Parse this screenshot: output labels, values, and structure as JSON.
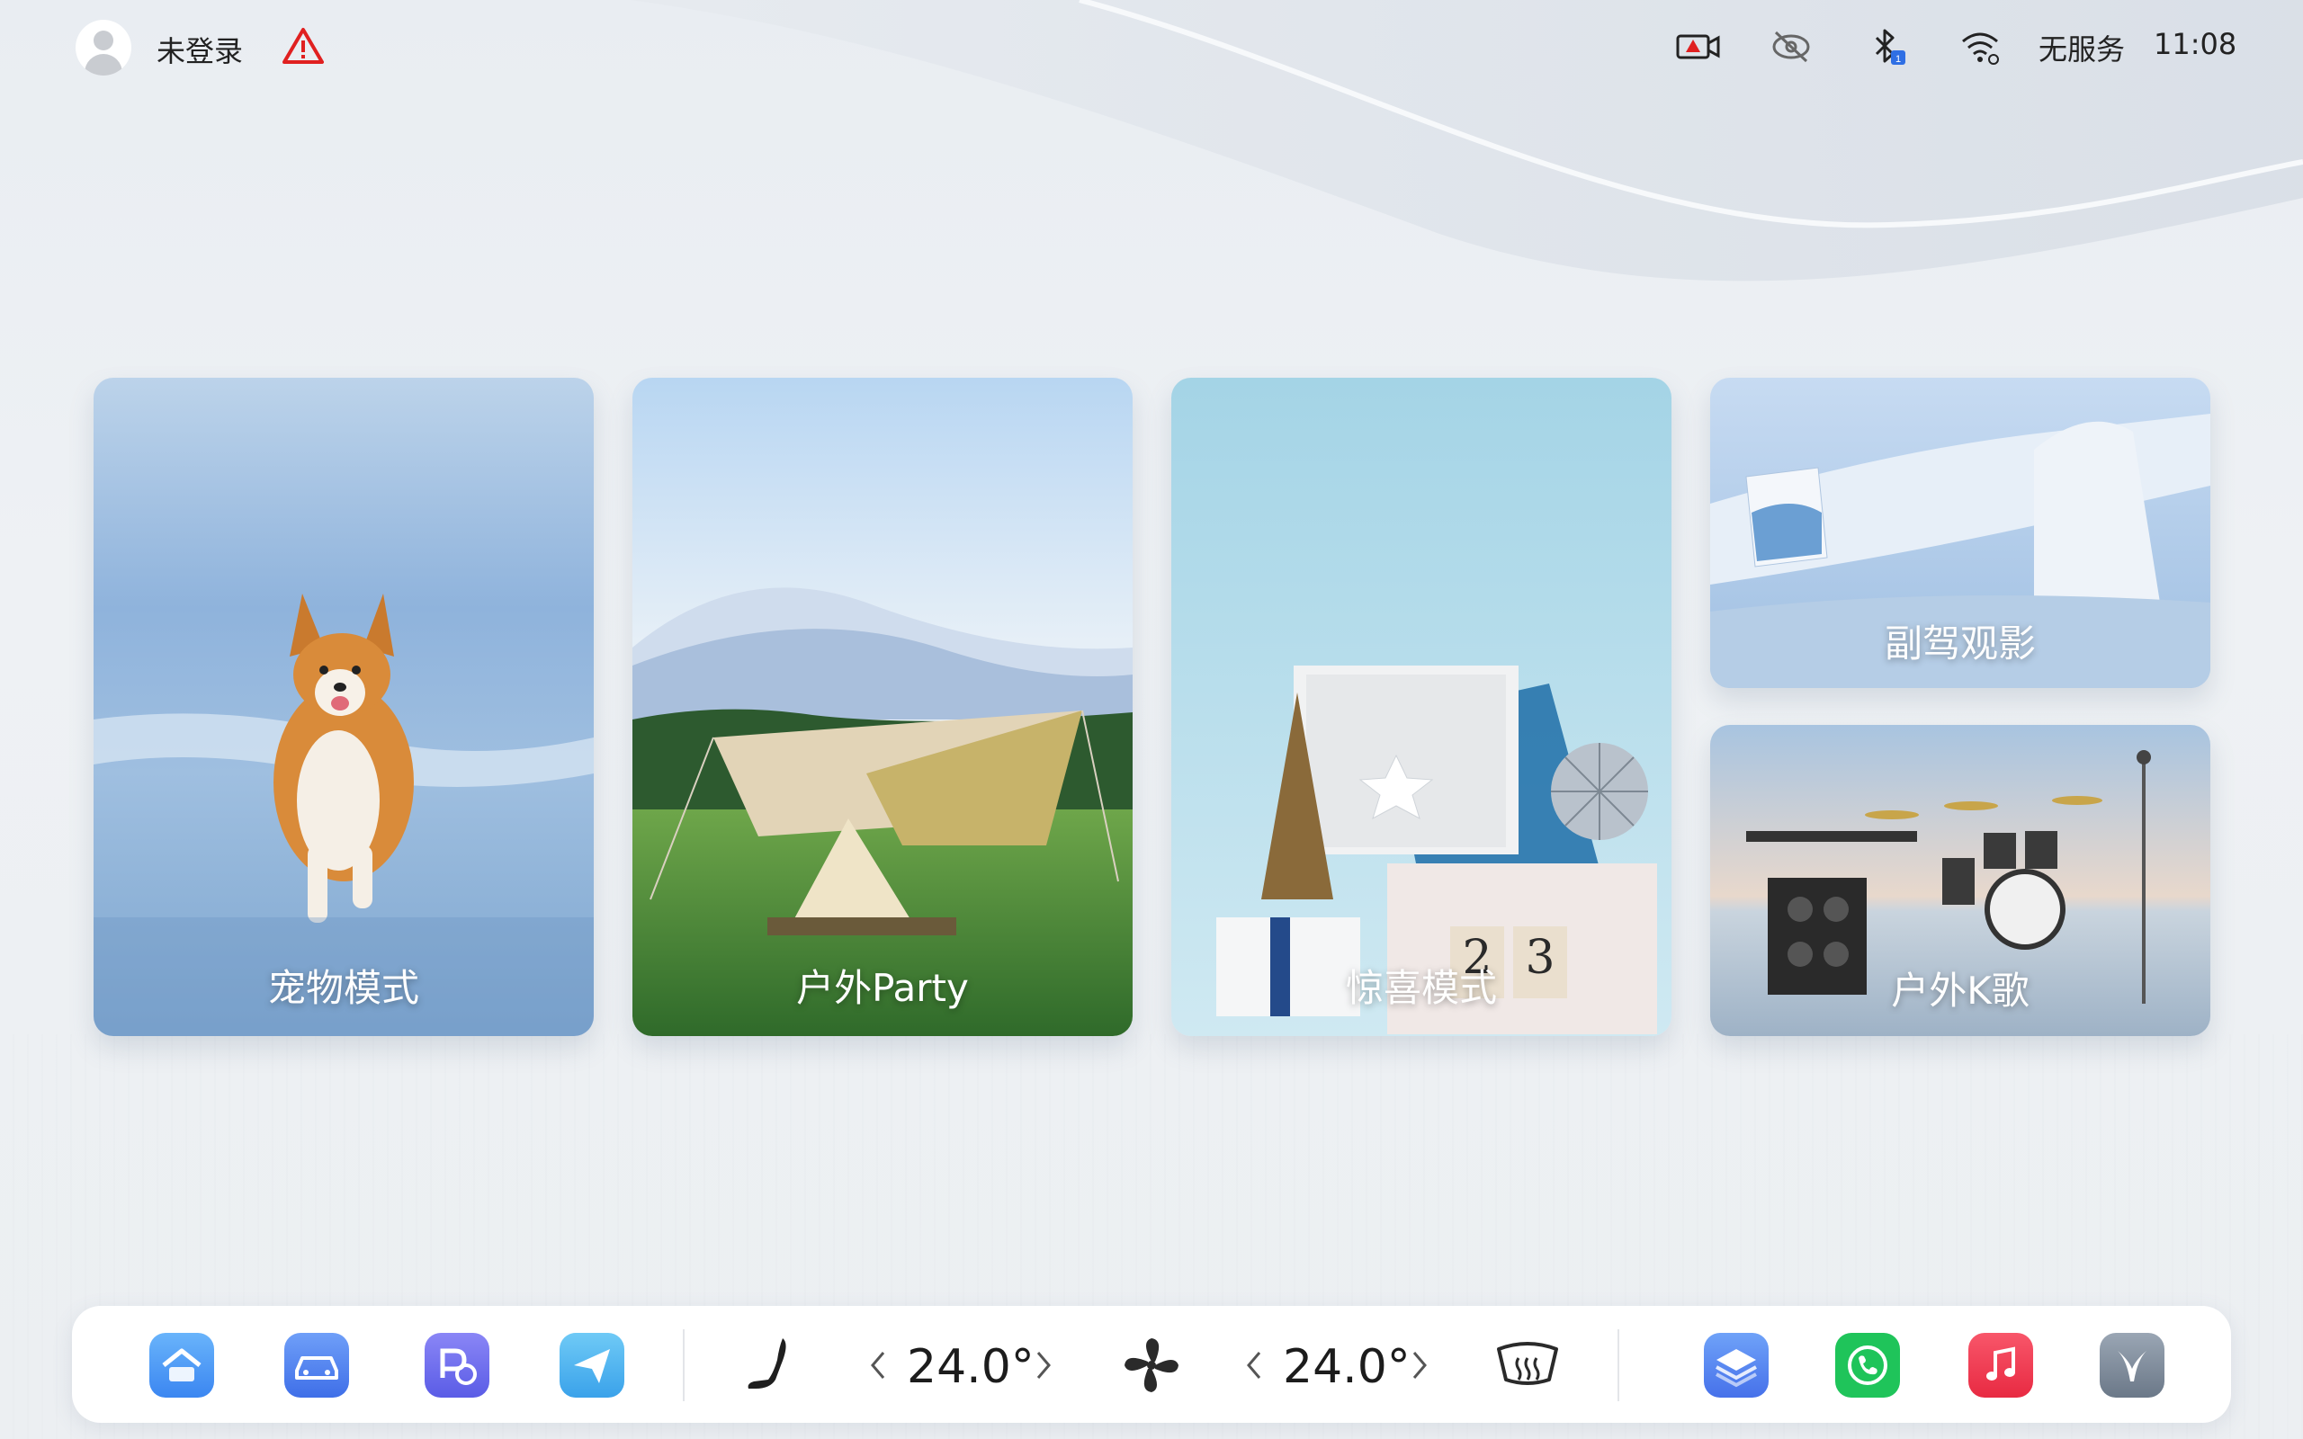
{
  "status_bar": {
    "login_status": "未登录",
    "service_status": "无服务",
    "time": "11:08",
    "bluetooth_badge": "1",
    "icons": [
      "avatar-icon",
      "warning-icon",
      "camera-alert-icon",
      "link-off-icon",
      "bluetooth-icon",
      "wifi-icon"
    ]
  },
  "cards": [
    {
      "label": "宠物模式"
    },
    {
      "label": "户外Party"
    },
    {
      "label": "惊喜模式"
    },
    {
      "label": "副驾观影"
    },
    {
      "label": "户外K歌"
    }
  ],
  "dock": {
    "apps_left": [
      "home-app-icon",
      "car-app-icon",
      "parking-app-icon",
      "navigation-app-icon"
    ],
    "apps_right": [
      "layers-app-icon",
      "phone-app-icon",
      "music-app-icon",
      "brand-app-icon"
    ],
    "climate": {
      "left_temp": "24.0°",
      "right_temp": "24.0°"
    }
  },
  "colors": {
    "accent_blue": "#4a8df5",
    "phone_green": "#1fc45a",
    "music_red": "#f0344d",
    "warning_red": "#e02020"
  }
}
